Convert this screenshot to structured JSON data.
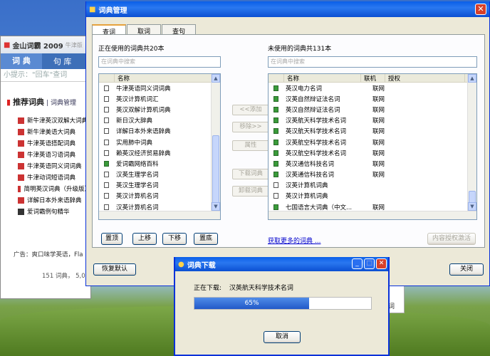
{
  "bg_app": {
    "title": "金山词霸 2009",
    "edition": "牛津版",
    "tabs": [
      "词 典",
      "句 库"
    ],
    "hint": "小提示：\"回车\"查词",
    "heading": "推荐词典",
    "manage_link": "| 词典管理",
    "items": [
      "新牛津英汉双解大词典",
      "新牛津美语大词典",
      "牛津英语搭配词典",
      "牛津英语习语词典",
      "牛津英语同义词词典",
      "牛津动词短语词典",
      "简明英汉词典（升级版）",
      "详解日本外来语辞典",
      "爱词霸例句精华"
    ],
    "ad": "广告：爽口味学英语，Fla",
    "footer": "151 词典， 5,00"
  },
  "manager": {
    "title": "词典管理",
    "tabs": [
      "查词",
      "取词",
      "查句"
    ],
    "used_label": "正在使用的词典共20本",
    "unused_label": "未使用的词典共131本",
    "search_placeholder": "在词典中搜索",
    "col_name": "名称",
    "col_net": "联机",
    "col_auth": "授权",
    "used_list": [
      "牛津英语同义词词典",
      "英汉计算机词汇",
      "英汉双解计算机词典",
      "新日汉大辞典",
      "详解日本外来语辞典",
      "实用肺中词典",
      "赖英汉经济贸易辞典",
      "爱词霸网络百科",
      "汉英生理学名词",
      "英汉生理学名词",
      "英汉计算机名词",
      "汉英计算机名词"
    ],
    "unused_list": [
      {
        "name": "英汉电力名词",
        "status": "联网"
      },
      {
        "name": "汉英自然辩证法名词",
        "status": "联网"
      },
      {
        "name": "英汉自然辩证法名词",
        "status": "联网"
      },
      {
        "name": "汉英航天科学技术名词",
        "status": "联网"
      },
      {
        "name": "英汉航天科学技术名词",
        "status": "联网"
      },
      {
        "name": "汉英航空科学技术名词",
        "status": "联网"
      },
      {
        "name": "英汉航空科学技术名词",
        "status": "联网"
      },
      {
        "name": "英汉通信科技名词",
        "status": "联网"
      },
      {
        "name": "汉英通信科技名词",
        "status": "联网"
      },
      {
        "name": "汉英计算机词典",
        "status": ""
      },
      {
        "name": "英汉计算机词典",
        "status": ""
      },
      {
        "name": "七国语言大词典（中文...",
        "status": "联网"
      }
    ],
    "mid_buttons": [
      "<<添加",
      "移除>>",
      "属性",
      "下载词典",
      "卸载词典"
    ],
    "order_buttons": [
      "置顶",
      "上移",
      "下移",
      "置底"
    ],
    "more_link": "获取更多的词典 ...",
    "auth_button": "内容授权激活",
    "restore_button": "恢复默认",
    "close_button": "关闭",
    "close_x": "✕"
  },
  "download": {
    "title": "词典下载",
    "label": "正在下载:",
    "item": "汉英航天科学技术名词",
    "percent": "65%",
    "progress": 0.65,
    "cancel": "取消",
    "ctrl": [
      "_",
      "□",
      "✕"
    ]
  },
  "bg_partial": "词"
}
